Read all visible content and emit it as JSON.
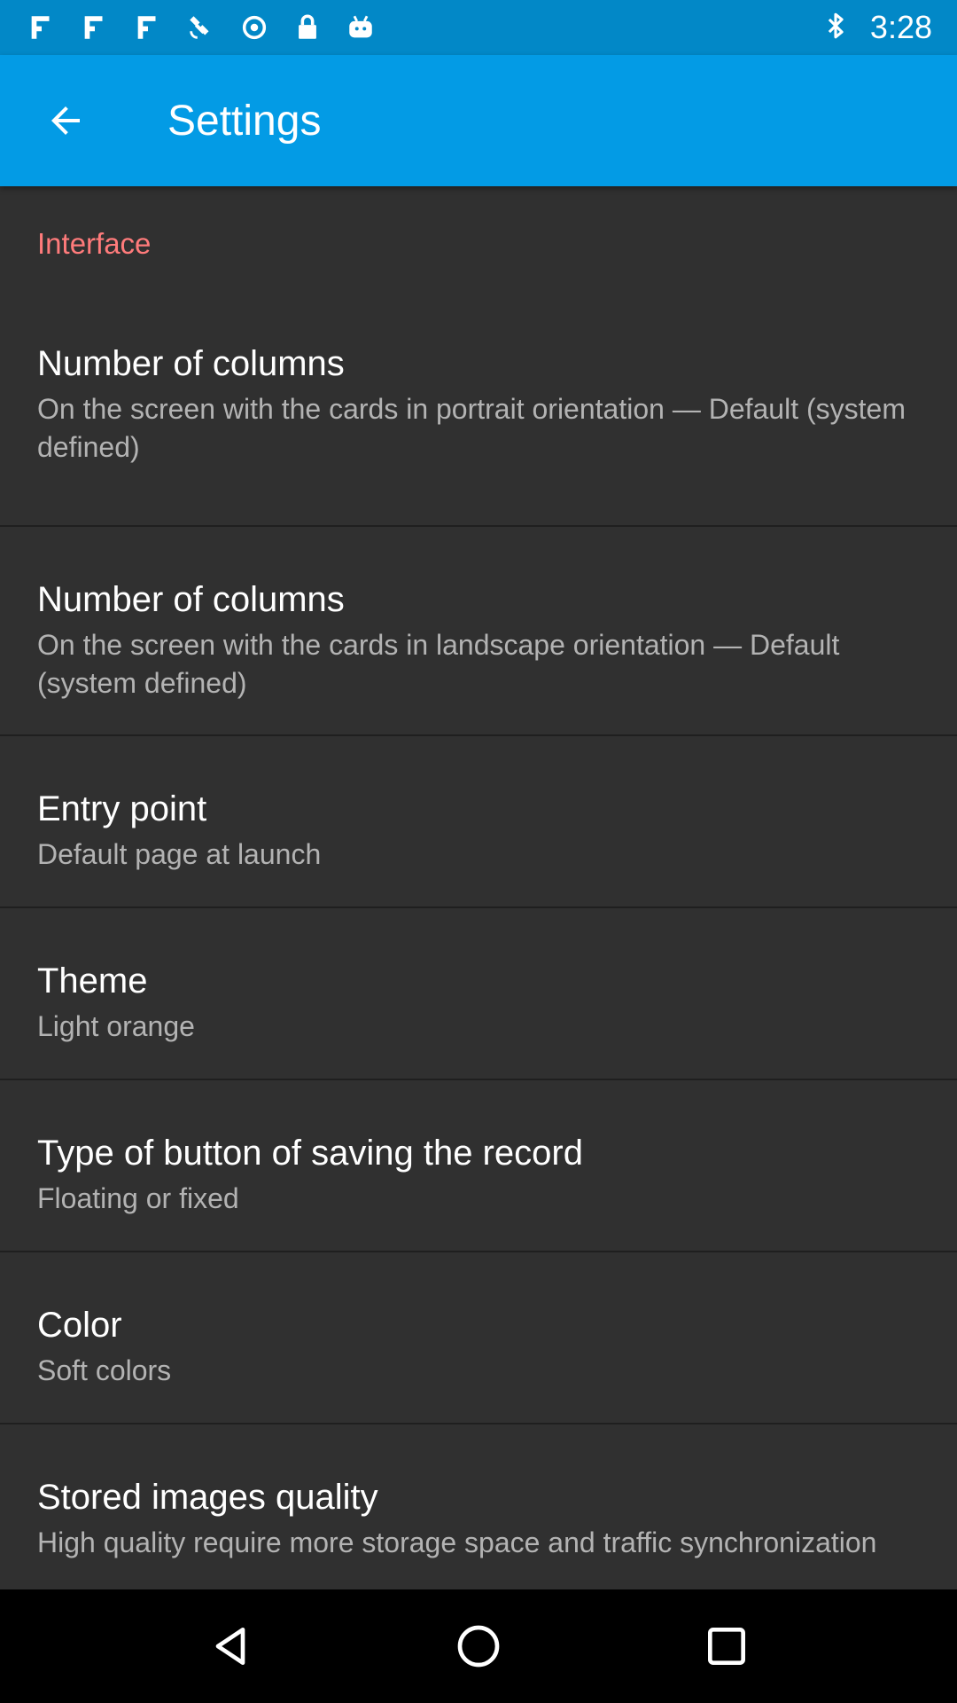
{
  "status_bar": {
    "time": "3:28",
    "icons": [
      "notification-icon",
      "notification-icon",
      "notification-icon",
      "satellite-icon",
      "sync-icon",
      "lock-icon",
      "android-icon"
    ],
    "right_icons": [
      "bluetooth-icon"
    ]
  },
  "app_bar": {
    "title": "Settings",
    "background": "#039be5"
  },
  "section": {
    "header": "Interface",
    "header_color": "#ff7b7b"
  },
  "preferences": [
    {
      "title": "Number of columns",
      "summary": "On the screen with the cards in portrait orientation — Default (system defined)"
    },
    {
      "title": "Number of columns",
      "summary": "On the screen with the cards in landscape orientation — Default (system defined)"
    },
    {
      "title": "Entry point",
      "summary": "Default page at launch"
    },
    {
      "title": "Theme",
      "summary": "Light orange"
    },
    {
      "title": "Type of button of saving the record",
      "summary": "Floating or fixed"
    },
    {
      "title": "Color",
      "summary": "Soft colors"
    },
    {
      "title": "Stored images quality",
      "summary": "High quality require more storage space and traffic synchronization"
    }
  ],
  "nav_bar": {
    "buttons": [
      "back-icon",
      "home-icon",
      "recents-icon"
    ]
  }
}
